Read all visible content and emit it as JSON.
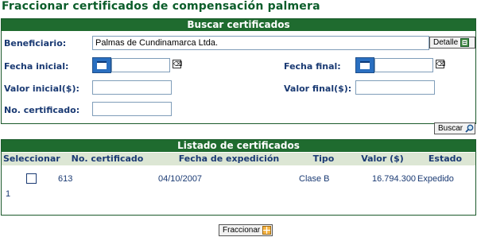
{
  "page": {
    "title": "Fraccionar certificados de compensación palmera"
  },
  "search": {
    "header": "Buscar certificados",
    "beneficiario_label": "Beneficiario:",
    "beneficiario_value": "Palmas de Cundinamarca Ltda.",
    "detalle_label": "Detalle",
    "fecha_inicial_label": "Fecha inicial:",
    "fecha_inicial_value": "",
    "fecha_final_label": "Fecha final:",
    "fecha_final_value": "",
    "valor_inicial_label": "Valor inicial($):",
    "valor_inicial_value": "",
    "valor_final_label": "Valor final($):",
    "valor_final_value": "",
    "no_certificado_label": "No. certificado:",
    "no_certificado_value": "",
    "buscar_label": "Buscar"
  },
  "list": {
    "header": "Listado de certificados",
    "columns": [
      "Seleccionar",
      "No. certificado",
      "Fecha de expedición",
      "Tipo",
      "Valor ($)",
      "Estado"
    ],
    "rows": [
      {
        "selected": false,
        "no_certificado": "613",
        "fecha": "04/10/2007",
        "tipo": "Clase B",
        "valor": "16.794.300",
        "estado": "Expedido"
      }
    ],
    "page": "1"
  },
  "actions": {
    "fraccionar_label": "Fraccionar"
  },
  "colors": {
    "header_bg": "#1f6b2f",
    "title": "#0b5d2a",
    "label": "#1a3a73",
    "table_head_bg": "#dce6d4"
  }
}
